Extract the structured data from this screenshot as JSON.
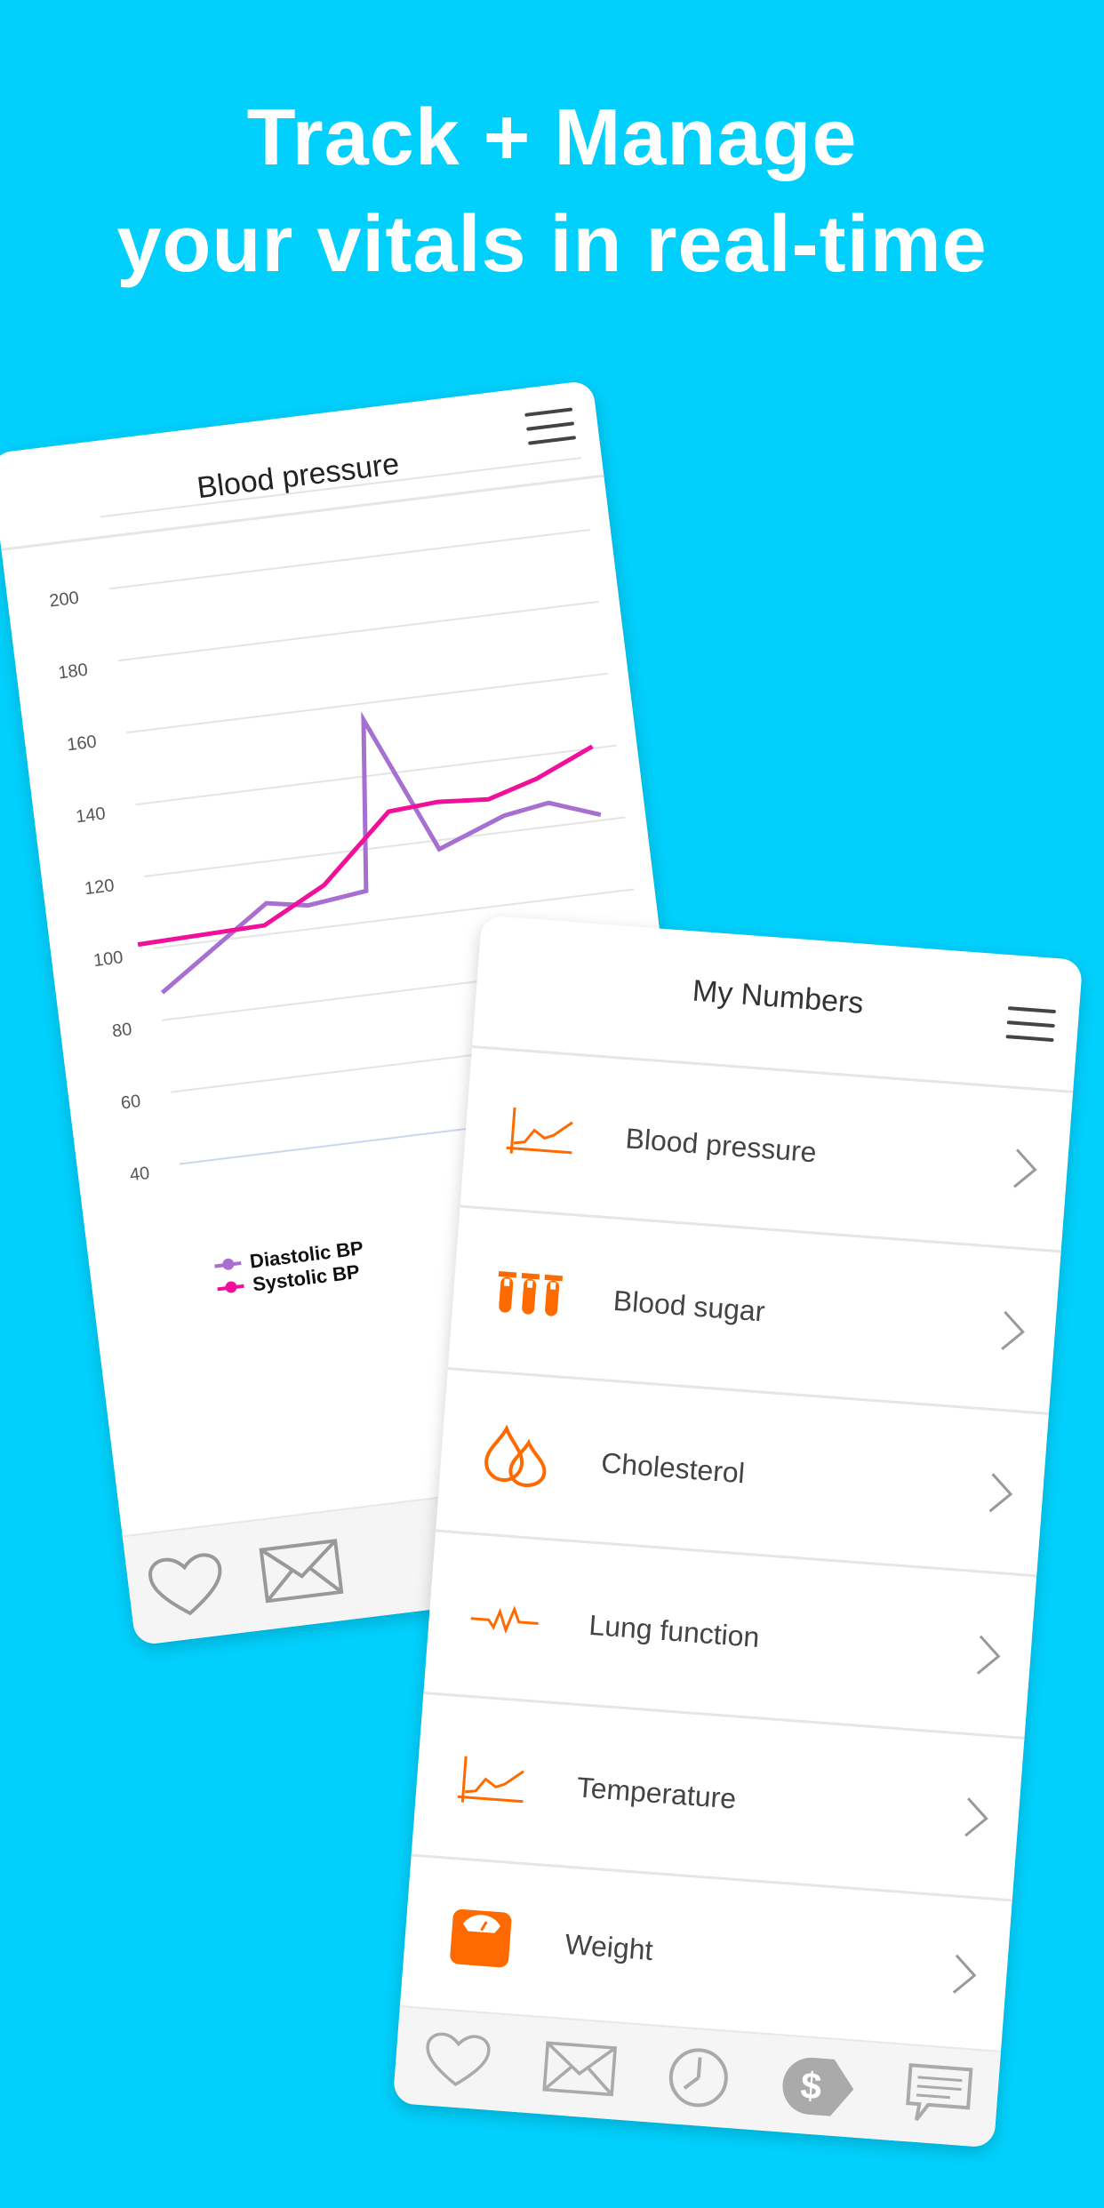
{
  "headline": {
    "line1": "Track + Manage",
    "line2": "your vitals in real-time"
  },
  "colors": {
    "background": "#02D0FC",
    "accent": "#FF6A00",
    "diastolic": "#A66FD0",
    "systolic": "#F0109A"
  },
  "back_screen": {
    "title": "Blood pressure",
    "nav_icons": [
      "heart-icon",
      "envelope-icon"
    ]
  },
  "chart_data": {
    "type": "line",
    "title": "",
    "xlabel": "",
    "ylabel": "",
    "ylim": [
      40,
      220
    ],
    "yticks": [
      "200",
      "180",
      "160",
      "140",
      "120",
      "100",
      "80",
      "60",
      "40"
    ],
    "grid": true,
    "legend_position": "bottom-left",
    "series": [
      {
        "name": "Diastolic BP",
        "color": "#A66FD0",
        "points": [
          [
            0,
            90
          ],
          [
            2.5,
            111
          ],
          [
            3.4,
            109
          ],
          [
            4.7,
            111
          ],
          [
            5.1,
            158
          ],
          [
            6.4,
            120
          ],
          [
            7.9,
            127
          ],
          [
            8.9,
            129
          ],
          [
            10,
            124
          ]
        ]
      },
      {
        "name": "Systolic BP",
        "color": "#F0109A",
        "points": [
          [
            -0.4,
            104
          ],
          [
            2.4,
            105
          ],
          [
            3.8,
            114
          ],
          [
            5.4,
            132
          ],
          [
            6.5,
            133
          ],
          [
            7.6,
            132
          ],
          [
            8.7,
            136
          ],
          [
            10,
            143
          ]
        ]
      }
    ]
  },
  "front_screen": {
    "title": "My Numbers",
    "items": [
      {
        "label": "Blood pressure",
        "icon": "chart-line-icon"
      },
      {
        "label": "Blood sugar",
        "icon": "test-tubes-icon"
      },
      {
        "label": "Cholesterol",
        "icon": "drops-icon"
      },
      {
        "label": "Lung function",
        "icon": "pulse-icon"
      },
      {
        "label": "Temperature",
        "icon": "chart-line-icon"
      },
      {
        "label": "Weight",
        "icon": "scale-icon"
      }
    ],
    "nav_icons": [
      "heart-icon",
      "envelope-icon",
      "clock-icon",
      "dollar-tag-icon",
      "chat-icon"
    ]
  }
}
